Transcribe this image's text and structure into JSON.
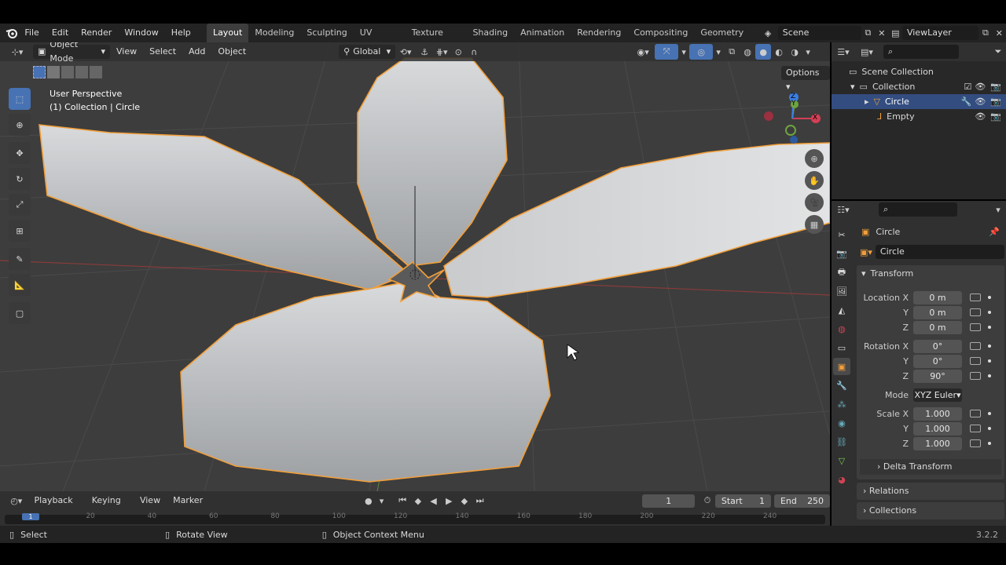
{
  "colors": {
    "accent": "#4772b3",
    "selection": "#f29f3a",
    "bg_viewport": "#3d3d3d"
  },
  "menu": {
    "items": [
      "File",
      "Edit",
      "Render",
      "Window",
      "Help"
    ]
  },
  "workspaces": [
    "Layout",
    "Modeling",
    "Sculpting",
    "UV Editing",
    "Texture Paint",
    "Shading",
    "Animation",
    "Rendering",
    "Compositing",
    "Geometry Noc"
  ],
  "scene": {
    "name": "Scene"
  },
  "viewlayer": {
    "name": "ViewLayer"
  },
  "header3d": {
    "mode": "Object Mode",
    "view": "View",
    "select": "Select",
    "add": "Add",
    "object": "Object",
    "orientation": "Global",
    "options": "Options"
  },
  "viewport": {
    "perspective": "User Perspective",
    "collection": "(1) Collection | Circle",
    "gizmo_x": "X",
    "gizmo_y": "Y",
    "gizmo_z": "Z"
  },
  "outliner": {
    "scene_collection": "Scene Collection",
    "collection": "Collection",
    "items": [
      "Circle",
      "Empty"
    ]
  },
  "properties": {
    "object_name": "Circle",
    "data_name": "Circle",
    "transform_label": "Transform",
    "location_label": "Location X",
    "loc_y": "Y",
    "loc_z": "Z",
    "location": [
      "0 m",
      "0 m",
      "0 m"
    ],
    "rotation_label": "Rotation X",
    "rot_y": "Y",
    "rot_z": "Z",
    "rotation": [
      "0°",
      "0°",
      "90°"
    ],
    "mode_label": "Mode",
    "mode_value": "XYZ Euler",
    "scale_label": "Scale X",
    "scale_y": "Y",
    "scale_z": "Z",
    "scale": [
      "1.000",
      "1.000",
      "1.000"
    ],
    "delta_transform": "Delta Transform",
    "relations": "Relations",
    "collections": "Collections"
  },
  "timeline": {
    "playback": "Playback",
    "keying": "Keying",
    "view": "View",
    "marker": "Marker",
    "current_frame": "1",
    "start_label": "Start",
    "start": "1",
    "end_label": "End",
    "end": "250",
    "ticks": [
      "1",
      "20",
      "40",
      "60",
      "80",
      "100",
      "120",
      "140",
      "160",
      "180",
      "200",
      "220",
      "240"
    ]
  },
  "status": {
    "select": "Select",
    "rotate_view": "Rotate View",
    "context_menu": "Object Context Menu",
    "version": "3.2.2"
  }
}
